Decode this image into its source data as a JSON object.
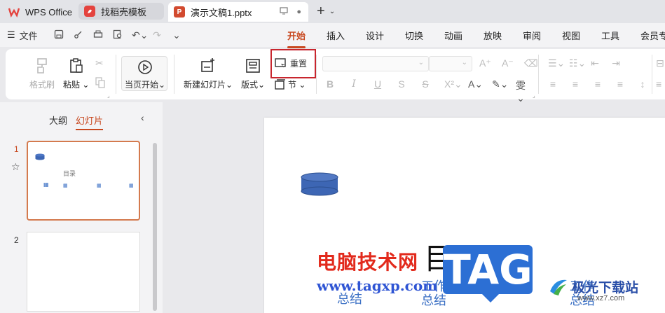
{
  "tabs": [
    {
      "label": "WPS Office"
    },
    {
      "label": "找稻壳模板"
    },
    {
      "label": "演示文稿1.pptx"
    }
  ],
  "menu": {
    "file_label": "文件",
    "tabs": [
      "开始",
      "插入",
      "设计",
      "切换",
      "动画",
      "放映",
      "审阅",
      "视图",
      "工具",
      "会员专"
    ],
    "active_tab": "开始"
  },
  "ribbon": {
    "format_painter": "格式刷",
    "paste": "粘贴",
    "play_from_current": "当页开始",
    "new_slide": "新建幻灯片",
    "layout": "版式",
    "reset": "重置",
    "section": "节"
  },
  "left_pane": {
    "tab_outline": "大纲",
    "tab_slides": "幻灯片",
    "slide_numbers": [
      "1",
      "2"
    ],
    "thumb_title": "目录"
  },
  "slide": {
    "title": "目录",
    "items": [
      "总结",
      "工作\n总结",
      "工作\n总结"
    ]
  },
  "watermark": {
    "cn": "电脑技术网",
    "url": "www.tagxp.com",
    "tag": "TAG",
    "site_cn": "极光下载站",
    "site_url": "www.xz7.com"
  },
  "colors": {
    "accent": "#c8481f",
    "highlight_box": "#c8262e",
    "slide_shape": "#3d66b4"
  }
}
